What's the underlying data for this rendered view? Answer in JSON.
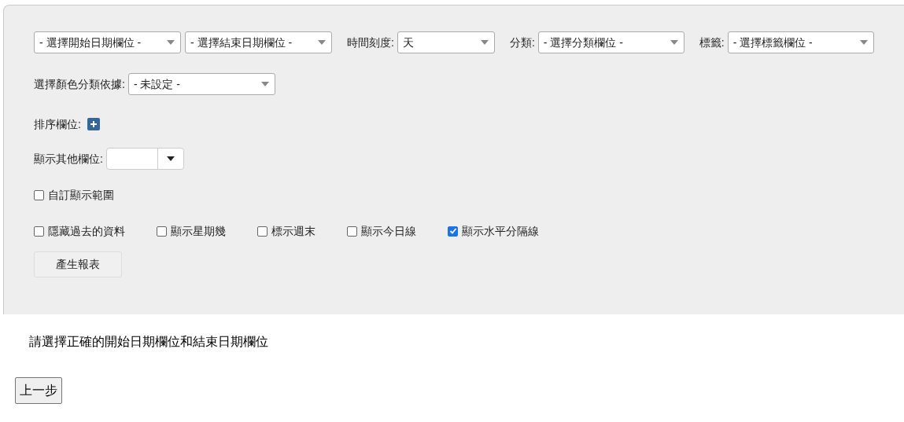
{
  "row_1": [
    {
      "kind": "select",
      "value": "- 選擇開始日期欄位 -"
    },
    {
      "kind": "select",
      "value": "- 選擇結束日期欄位 -"
    },
    {
      "kind": "labeled_select",
      "label": "時間刻度:",
      "value": "天"
    },
    {
      "kind": "labeled_select",
      "label": "分類:",
      "value": "- 選擇分類欄位 -"
    },
    {
      "kind": "labeled_select",
      "label": "標籤:",
      "value": "- 選擇標籤欄位 -"
    }
  ],
  "color_by": {
    "label": "選擇顏色分類依據:",
    "value": "- 未設定 -"
  },
  "sort_fields": {
    "label": "排序欄位:"
  },
  "other_fields": {
    "label": "顯示其他欄位:"
  },
  "custom_range": {
    "label": "自訂顯示範圍",
    "checked": false
  },
  "options": [
    {
      "label": "隱藏過去的資料",
      "checked": false
    },
    {
      "label": "顯示星期幾",
      "checked": false
    },
    {
      "label": "標示週末",
      "checked": false
    },
    {
      "label": "顯示今日線",
      "checked": false
    },
    {
      "label": "顯示水平分隔線",
      "checked": true
    }
  ],
  "generate_button": "產生報表",
  "message": "請選擇正確的開始日期欄位和結束日期欄位",
  "back_button": "上一步"
}
